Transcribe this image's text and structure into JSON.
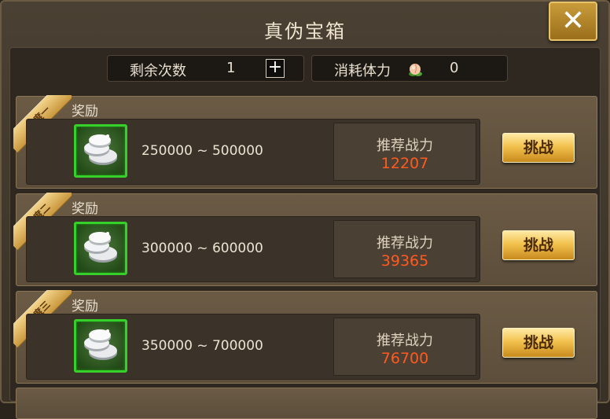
{
  "title": "真伪宝箱",
  "stats": {
    "remaining_label": "剩余次数",
    "remaining_value": "1",
    "plus": "+",
    "cost_label": "消耗体力",
    "cost_value": "0"
  },
  "rows": [
    {
      "difficulty": "难度一",
      "reward_label": "奖励",
      "range": "250000 ~ 500000",
      "power_label": "推荐战力",
      "power_value": "12207",
      "button": "挑战"
    },
    {
      "difficulty": "难度二",
      "reward_label": "奖励",
      "range": "300000 ~ 600000",
      "power_label": "推荐战力",
      "power_value": "39365",
      "button": "挑战"
    },
    {
      "difficulty": "难度三",
      "reward_label": "奖励",
      "range": "350000 ~ 700000",
      "power_label": "推荐战力",
      "power_value": "76700",
      "button": "挑战"
    }
  ],
  "close_symbol": "✕",
  "colors": {
    "accent_gold": "#f2c24e",
    "power_red": "#ff5a1f",
    "item_border_green": "#36d02a"
  },
  "icons": [
    "close-icon",
    "plus-icon",
    "peach-icon",
    "silver-coins-icon"
  ]
}
